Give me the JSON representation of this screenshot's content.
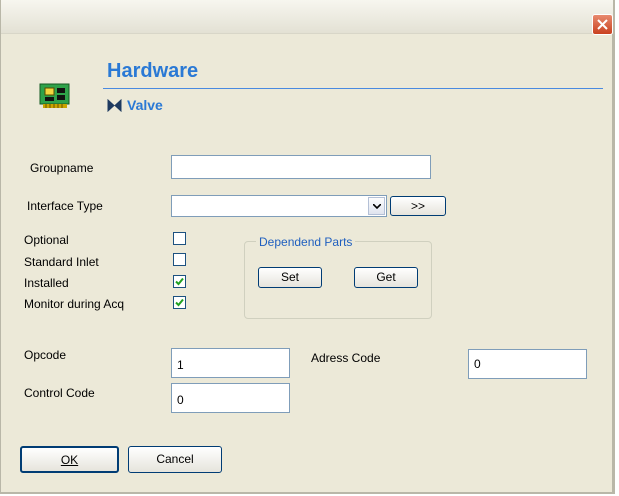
{
  "header": {
    "title": "Hardware",
    "subtitle": "Valve"
  },
  "form": {
    "groupname": {
      "label": "Groupname",
      "value": ""
    },
    "interface_type": {
      "label": "Interface Type",
      "value": "",
      "more_label": ">>"
    },
    "options": [
      {
        "label": "Optional",
        "checked": false
      },
      {
        "label": "Standard Inlet",
        "checked": false
      },
      {
        "label": "Installed",
        "checked": true
      },
      {
        "label": "Monitor during Acq",
        "checked": true
      }
    ],
    "dependend_parts": {
      "label": "Dependend Parts",
      "set_label": "Set",
      "get_label": "Get"
    },
    "opcode": {
      "label": "Opcode",
      "value": "1"
    },
    "address_code": {
      "label": "Adress Code",
      "value": "0"
    },
    "control_code": {
      "label": "Control Code",
      "value": "0"
    }
  },
  "footer": {
    "ok_label": "OK",
    "cancel_label": "Cancel"
  },
  "colors": {
    "accent": "#2a79d5",
    "window": "#ece9d8",
    "close": "#c9411f"
  }
}
